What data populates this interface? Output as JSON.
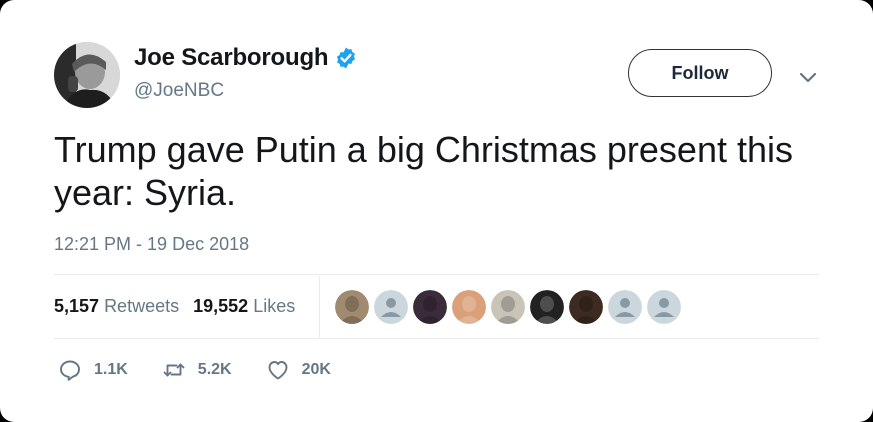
{
  "author": {
    "name": "Joe Scarborough",
    "handle": "@JoeNBC",
    "verified": true
  },
  "follow_label": "Follow",
  "tweet_text": "Trump gave Putin a big Christmas present this year: Syria.",
  "timestamp": "12:21 PM - 19 Dec 2018",
  "stats": {
    "retweets_count": "5,157",
    "retweets_label": "Retweets",
    "likes_count": "19,552",
    "likes_label": "Likes"
  },
  "likers": [
    {
      "kind": "photo",
      "color": "#a08a70"
    },
    {
      "kind": "default",
      "color": "#ccd6dd"
    },
    {
      "kind": "photo",
      "color": "#3a2c3a"
    },
    {
      "kind": "photo",
      "color": "#d9a07a"
    },
    {
      "kind": "photo",
      "color": "#c9c4b8"
    },
    {
      "kind": "photo",
      "color": "#222222"
    },
    {
      "kind": "photo",
      "color": "#3d2a20"
    },
    {
      "kind": "default",
      "color": "#ccd6dd"
    },
    {
      "kind": "default",
      "color": "#ccd6dd"
    }
  ],
  "actions": {
    "replies": "1.1K",
    "retweets": "5.2K",
    "likes": "20K"
  },
  "colors": {
    "accent": "#1da1f2",
    "secondary_text": "#657786",
    "primary_text": "#14171a"
  }
}
